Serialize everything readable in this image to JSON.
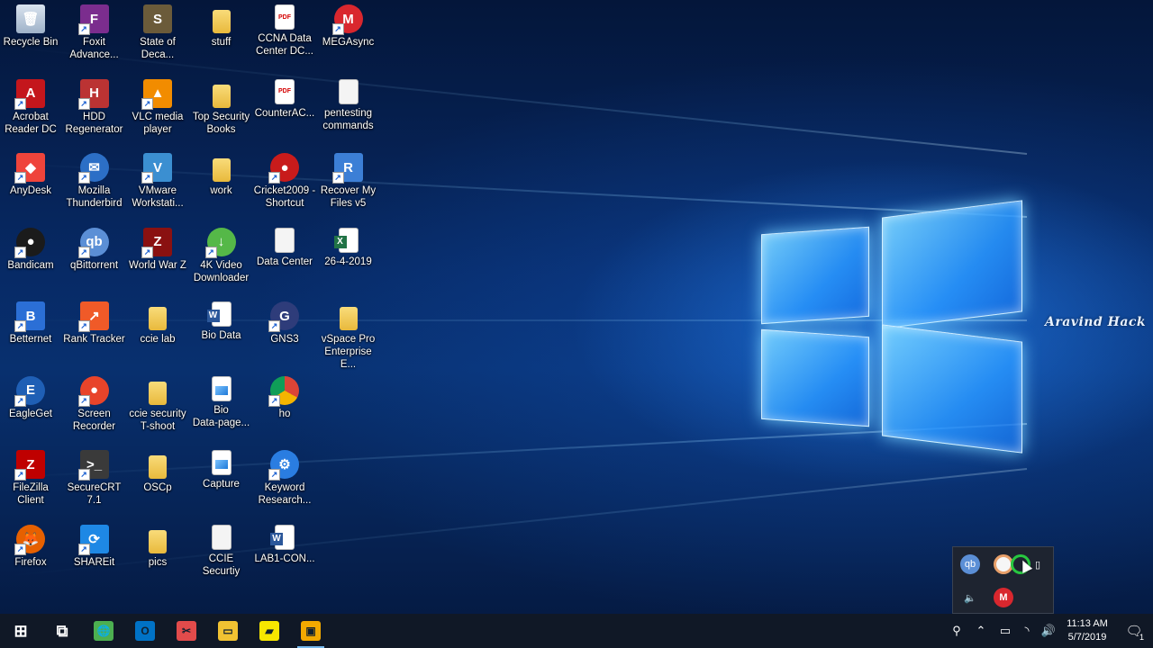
{
  "desktop": {
    "watermark": "Aravind Hack",
    "icons": [
      {
        "label": "Recycle Bin",
        "icon": "recycle-bin-icon",
        "col": 0,
        "row": 0
      },
      {
        "label": "Foxit\nAdvance...",
        "icon": "foxit-icon",
        "col": 1,
        "row": 0
      },
      {
        "label": "State of\nDeca...",
        "icon": "state-of-decay-icon",
        "col": 2,
        "row": 0
      },
      {
        "label": "stuff",
        "icon": "folder-icon",
        "col": 3,
        "row": 0
      },
      {
        "label": "CCNA Data\nCenter DC...",
        "icon": "pdf-icon",
        "col": 4,
        "row": 0
      },
      {
        "label": "MEGAsync",
        "icon": "mega-icon",
        "col": 5,
        "row": 0
      },
      {
        "label": "Acrobat\nReader DC",
        "icon": "acrobat-icon",
        "col": 0,
        "row": 1
      },
      {
        "label": "HDD\nRegenerator",
        "icon": "hdd-regenerator-icon",
        "col": 1,
        "row": 1
      },
      {
        "label": "VLC media\nplayer",
        "icon": "vlc-icon",
        "col": 2,
        "row": 1
      },
      {
        "label": "Top Security\nBooks",
        "icon": "folder-icon",
        "col": 3,
        "row": 1
      },
      {
        "label": "CounterAC...",
        "icon": "pdf-icon",
        "col": 4,
        "row": 1
      },
      {
        "label": "pentesting\ncommands",
        "icon": "text-file-icon",
        "col": 5,
        "row": 1
      },
      {
        "label": "AnyDesk",
        "icon": "anydesk-icon",
        "col": 0,
        "row": 2
      },
      {
        "label": "Mozilla\nThunderbird",
        "icon": "thunderbird-icon",
        "col": 1,
        "row": 2
      },
      {
        "label": "VMware\nWorkstati...",
        "icon": "vmware-icon",
        "col": 2,
        "row": 2
      },
      {
        "label": "work",
        "icon": "folder-icon",
        "col": 3,
        "row": 2
      },
      {
        "label": "Cricket2009 -\nShortcut",
        "icon": "cricket-icon",
        "col": 4,
        "row": 2
      },
      {
        "label": "Recover My\nFiles v5",
        "icon": "recover-files-icon",
        "col": 5,
        "row": 2
      },
      {
        "label": "Bandicam",
        "icon": "bandicam-icon",
        "col": 0,
        "row": 3
      },
      {
        "label": "qBittorrent",
        "icon": "qbittorrent-icon",
        "col": 1,
        "row": 3
      },
      {
        "label": "World War Z",
        "icon": "world-war-z-icon",
        "col": 2,
        "row": 3
      },
      {
        "label": "4K Video\nDownloader",
        "icon": "4k-video-downloader-icon",
        "col": 3,
        "row": 3
      },
      {
        "label": "Data Center",
        "icon": "text-file-icon",
        "col": 4,
        "row": 3
      },
      {
        "label": "26-4-2019",
        "icon": "excel-file-icon",
        "col": 5,
        "row": 3
      },
      {
        "label": "Betternet",
        "icon": "betternet-icon",
        "col": 0,
        "row": 4
      },
      {
        "label": "Rank Tracker",
        "icon": "rank-tracker-icon",
        "col": 1,
        "row": 4
      },
      {
        "label": "ccie lab",
        "icon": "folder-icon",
        "col": 2,
        "row": 4
      },
      {
        "label": "Bio Data",
        "icon": "word-file-icon",
        "col": 3,
        "row": 4
      },
      {
        "label": "GNS3",
        "icon": "gns3-icon",
        "col": 4,
        "row": 4
      },
      {
        "label": "vSpace Pro\nEnterprise E...",
        "icon": "folder-icon",
        "col": 5,
        "row": 4
      },
      {
        "label": "EagleGet",
        "icon": "eagleget-icon",
        "col": 0,
        "row": 5
      },
      {
        "label": "Screen\nRecorder",
        "icon": "screen-recorder-icon",
        "col": 1,
        "row": 5
      },
      {
        "label": "ccie security\nT-shoot",
        "icon": "folder-icon",
        "col": 2,
        "row": 5
      },
      {
        "label": "Bio\nData-page...",
        "icon": "image-file-icon",
        "col": 3,
        "row": 5
      },
      {
        "label": "ho",
        "icon": "chrome-icon",
        "col": 4,
        "row": 5
      },
      {
        "label": "FileZilla\nClient",
        "icon": "filezilla-icon",
        "col": 0,
        "row": 6
      },
      {
        "label": "SecureCRT\n7.1",
        "icon": "securecrt-icon",
        "col": 1,
        "row": 6
      },
      {
        "label": "OSCp",
        "icon": "folder-icon",
        "col": 2,
        "row": 6
      },
      {
        "label": "Capture",
        "icon": "image-file-icon",
        "col": 3,
        "row": 6
      },
      {
        "label": "Keyword\nResearch...",
        "icon": "keyword-research-icon",
        "col": 4,
        "row": 6
      },
      {
        "label": "Firefox",
        "icon": "firefox-icon",
        "col": 0,
        "row": 7
      },
      {
        "label": "SHAREit",
        "icon": "shareit-icon",
        "col": 1,
        "row": 7
      },
      {
        "label": "pics",
        "icon": "folder-icon",
        "col": 2,
        "row": 7
      },
      {
        "label": "CCIE Securtiy",
        "icon": "text-file-icon",
        "col": 3,
        "row": 7
      },
      {
        "label": "LAB1-CON...",
        "icon": "word-file-icon",
        "col": 4,
        "row": 7
      }
    ]
  },
  "taskbar": {
    "apps": [
      {
        "icon": "start-windows-icon",
        "glyph": "⊞",
        "color": "#ffffff"
      },
      {
        "icon": "task-view-icon",
        "glyph": "⧉",
        "color": "#ffffff"
      },
      {
        "icon": "globe-app-icon",
        "glyph": "🌐",
        "color": "#4caf50"
      },
      {
        "icon": "outlook-icon",
        "glyph": "O",
        "color": "#0072c6"
      },
      {
        "icon": "snipping-tool-icon",
        "glyph": "✂",
        "color": "#e24b4b"
      },
      {
        "icon": "file-explorer-icon",
        "glyph": "▭",
        "color": "#f1c232"
      },
      {
        "icon": "sticky-notes-icon",
        "glyph": "▰",
        "color": "#f7e600"
      },
      {
        "icon": "vmware-taskbar-icon",
        "glyph": "▣",
        "color": "#f2a900"
      }
    ],
    "clock": {
      "time": "11:13 AM",
      "date": "5/7/2019"
    },
    "notification_count": "1"
  },
  "tray_flyout": {
    "icons": [
      "qbittorrent-tray-icon",
      "white-circle-tray-icon",
      "green-ring-tray-icon",
      "usb-tray-icon",
      "volume-tray-icon",
      "mega-tray-icon"
    ]
  }
}
